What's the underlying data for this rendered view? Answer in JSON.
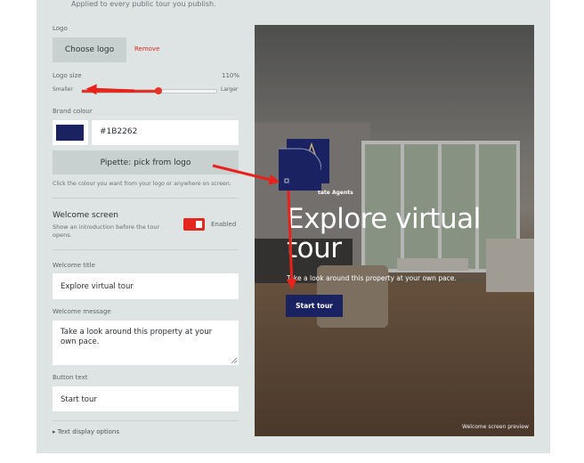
{
  "header": {
    "applied_text": "Applied to every public tour you publish."
  },
  "logo": {
    "label": "Logo",
    "choose_label": "Choose logo",
    "remove_label": "Remove"
  },
  "logo_size": {
    "label": "Logo size",
    "value_text": "110%",
    "min_label": "Smaller",
    "max_label": "Larger",
    "level_fraction": 0.57
  },
  "brand_colour": {
    "label": "Brand colour",
    "hex_value": "#1B2262",
    "swatch_color": "#1B2262",
    "pipette_label": "Pipette: pick from logo",
    "hint": "Click the colour you want from your logo or anywhere on screen."
  },
  "welcome_screen": {
    "title": "Welcome screen",
    "description": "Show an introduction before the tour opens.",
    "toggle_label": "Enabled",
    "enabled": true
  },
  "welcome_title": {
    "label": "Welcome title",
    "value": "Explore virtual tour"
  },
  "welcome_message": {
    "label": "Welcome message",
    "value": "Take a look around this property at your own pace."
  },
  "button_text": {
    "label": "Button text",
    "value": "Start tour"
  },
  "text_display_options": {
    "label": "Text display options",
    "icon": "caret-right-icon"
  },
  "preview": {
    "agency_name": "tate Agents",
    "headline": "Explore virtual tour",
    "message": "Take a look around this property at your own pace.",
    "button_label": "Start tour",
    "caption": "Welcome screen preview"
  },
  "colors": {
    "accent": "#E4281E",
    "brand": "#1B2262",
    "panel": "#DDE4E3"
  }
}
